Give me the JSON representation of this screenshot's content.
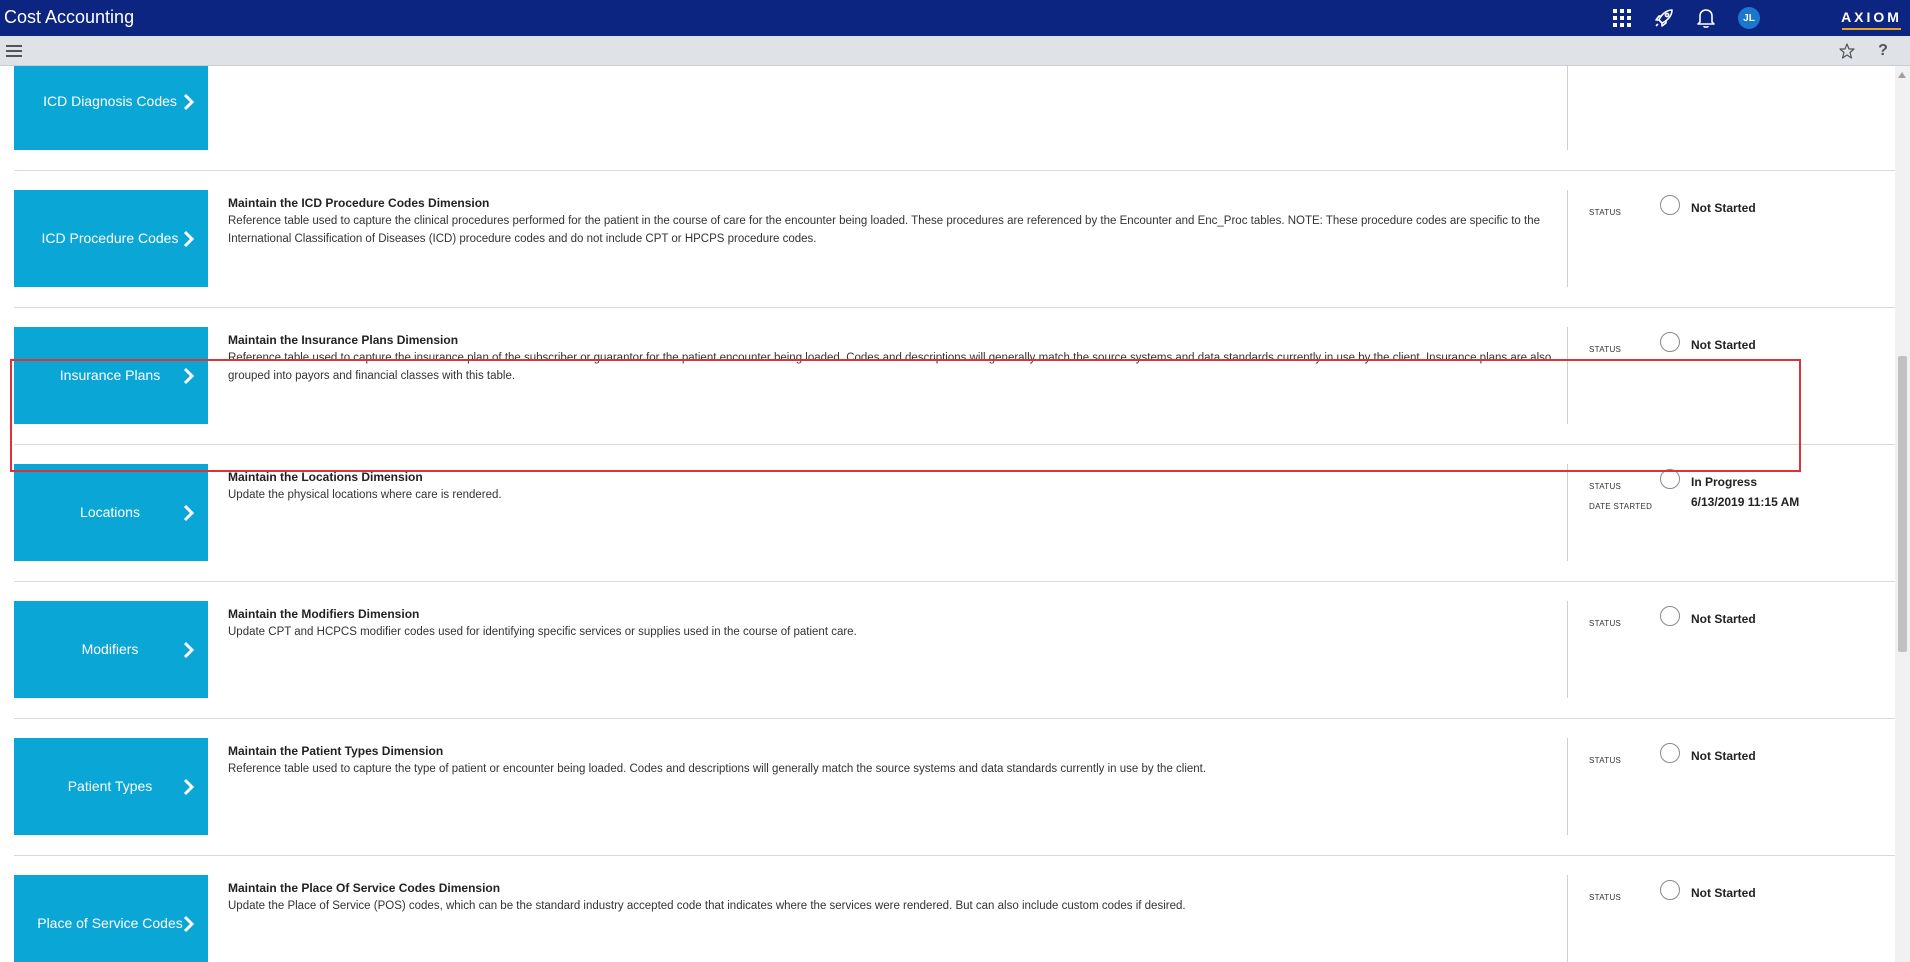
{
  "app": {
    "title": "Cost Accounting",
    "brand": "AXIOM",
    "user_initials": "JL"
  },
  "topbar_icons": [
    "apps-grid-icon",
    "rocket-icon",
    "bell-icon"
  ],
  "subbar_icons": [
    "hamburger-menu-icon",
    "star-icon",
    "help-icon"
  ],
  "labels": {
    "status": "STATUS",
    "date_started": "DATE STARTED"
  },
  "rows": [
    {
      "tile": "ICD Diagnosis Codes",
      "title": "",
      "description": "",
      "status": "",
      "date_started": ""
    },
    {
      "tile": "ICD Procedure Codes",
      "title": "Maintain the ICD Procedure Codes Dimension",
      "description": "Reference table used to capture the clinical procedures performed for the patient in the course of care for the encounter being loaded. These procedures are referenced by the Encounter and Enc_Proc tables. NOTE: These procedure codes are specific to the International Classification of Diseases (ICD) procedure codes and do not include CPT or HPCPS procedure codes.",
      "status": "Not Started",
      "date_started": ""
    },
    {
      "tile": "Insurance Plans",
      "title": "Maintain the Insurance Plans Dimension",
      "description": "Reference table used to capture the insurance plan of the subscriber or guarantor for the patient encounter being loaded. Codes and descriptions will generally match the source systems and data standards currently in use by the client. Insurance plans are also grouped into payors and financial classes with this table.",
      "status": "Not Started",
      "date_started": ""
    },
    {
      "tile": "Locations",
      "title": "Maintain the Locations Dimension",
      "description": "Update the physical locations where care is rendered.",
      "status": "In Progress",
      "date_started": "6/13/2019 11:15 AM"
    },
    {
      "tile": "Modifiers",
      "title": "Maintain the Modifiers Dimension",
      "description": "Update CPT and HCPCS modifier codes used for identifying specific services or supplies used in the course of patient care.",
      "status": "Not Started",
      "date_started": ""
    },
    {
      "tile": "Patient Types",
      "title": "Maintain the Patient Types Dimension",
      "description": "Reference table used to capture the type of patient or encounter being loaded. Codes and descriptions will generally match the source systems and data standards currently in use by the client.",
      "status": "Not Started",
      "date_started": ""
    },
    {
      "tile": "Place of Service Codes",
      "title": "Maintain the Place Of Service Codes Dimension",
      "description": "Update the Place of Service (POS) codes, which can be the standard industry accepted code that indicates where the services were rendered. But can also include custom codes if desired.",
      "status": "Not Started",
      "date_started": ""
    }
  ]
}
